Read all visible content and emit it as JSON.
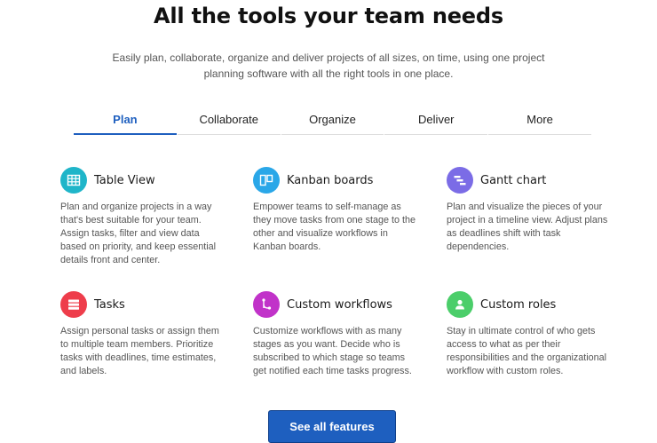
{
  "section": {
    "title": "All the tools your team needs",
    "subtitle": "Easily plan, collaborate, organize and deliver projects of all sizes, on time, using one project planning software with all the right tools in one place."
  },
  "tabs": [
    {
      "label": "Plan",
      "active": true
    },
    {
      "label": "Collaborate",
      "active": false
    },
    {
      "label": "Organize",
      "active": false
    },
    {
      "label": "Deliver",
      "active": false
    },
    {
      "label": "More",
      "active": false
    }
  ],
  "features": [
    {
      "title": "Table View",
      "icon": "table-icon",
      "color": "#1fb5c9",
      "description": "Plan and organize projects in a way that's best suitable for your team. Assign tasks, filter and view data based on priority, and keep essential details front and center."
    },
    {
      "title": "Kanban boards",
      "icon": "kanban-icon",
      "color": "#2aa7e8",
      "description": "Empower teams to self-manage as they move tasks from one stage to the other and visualize workflows in Kanban boards."
    },
    {
      "title": "Gantt chart",
      "icon": "gantt-icon",
      "color": "#7b6ce6",
      "description": "Plan and visualize the pieces of your project in a timeline view. Adjust plans as deadlines shift with task dependencies."
    },
    {
      "title": "Tasks",
      "icon": "tasks-icon",
      "color": "#ee3d4b",
      "description": "Assign personal tasks or assign them to multiple team members. Prioritize tasks with deadlines, time estimates, and labels."
    },
    {
      "title": "Custom workflows",
      "icon": "workflow-icon",
      "color": "#c133c9",
      "description": "Customize workflows with as many stages as you want. Decide who is subscribed to which stage so teams get notified each time tasks progress."
    },
    {
      "title": "Custom roles",
      "icon": "user-icon",
      "color": "#4bce6a",
      "description": "Stay in ultimate control of who gets access to what as per their responsibilities and the organizational workflow with custom roles."
    }
  ],
  "cta": {
    "label": "See all features",
    "color": "#1e5fbf"
  }
}
